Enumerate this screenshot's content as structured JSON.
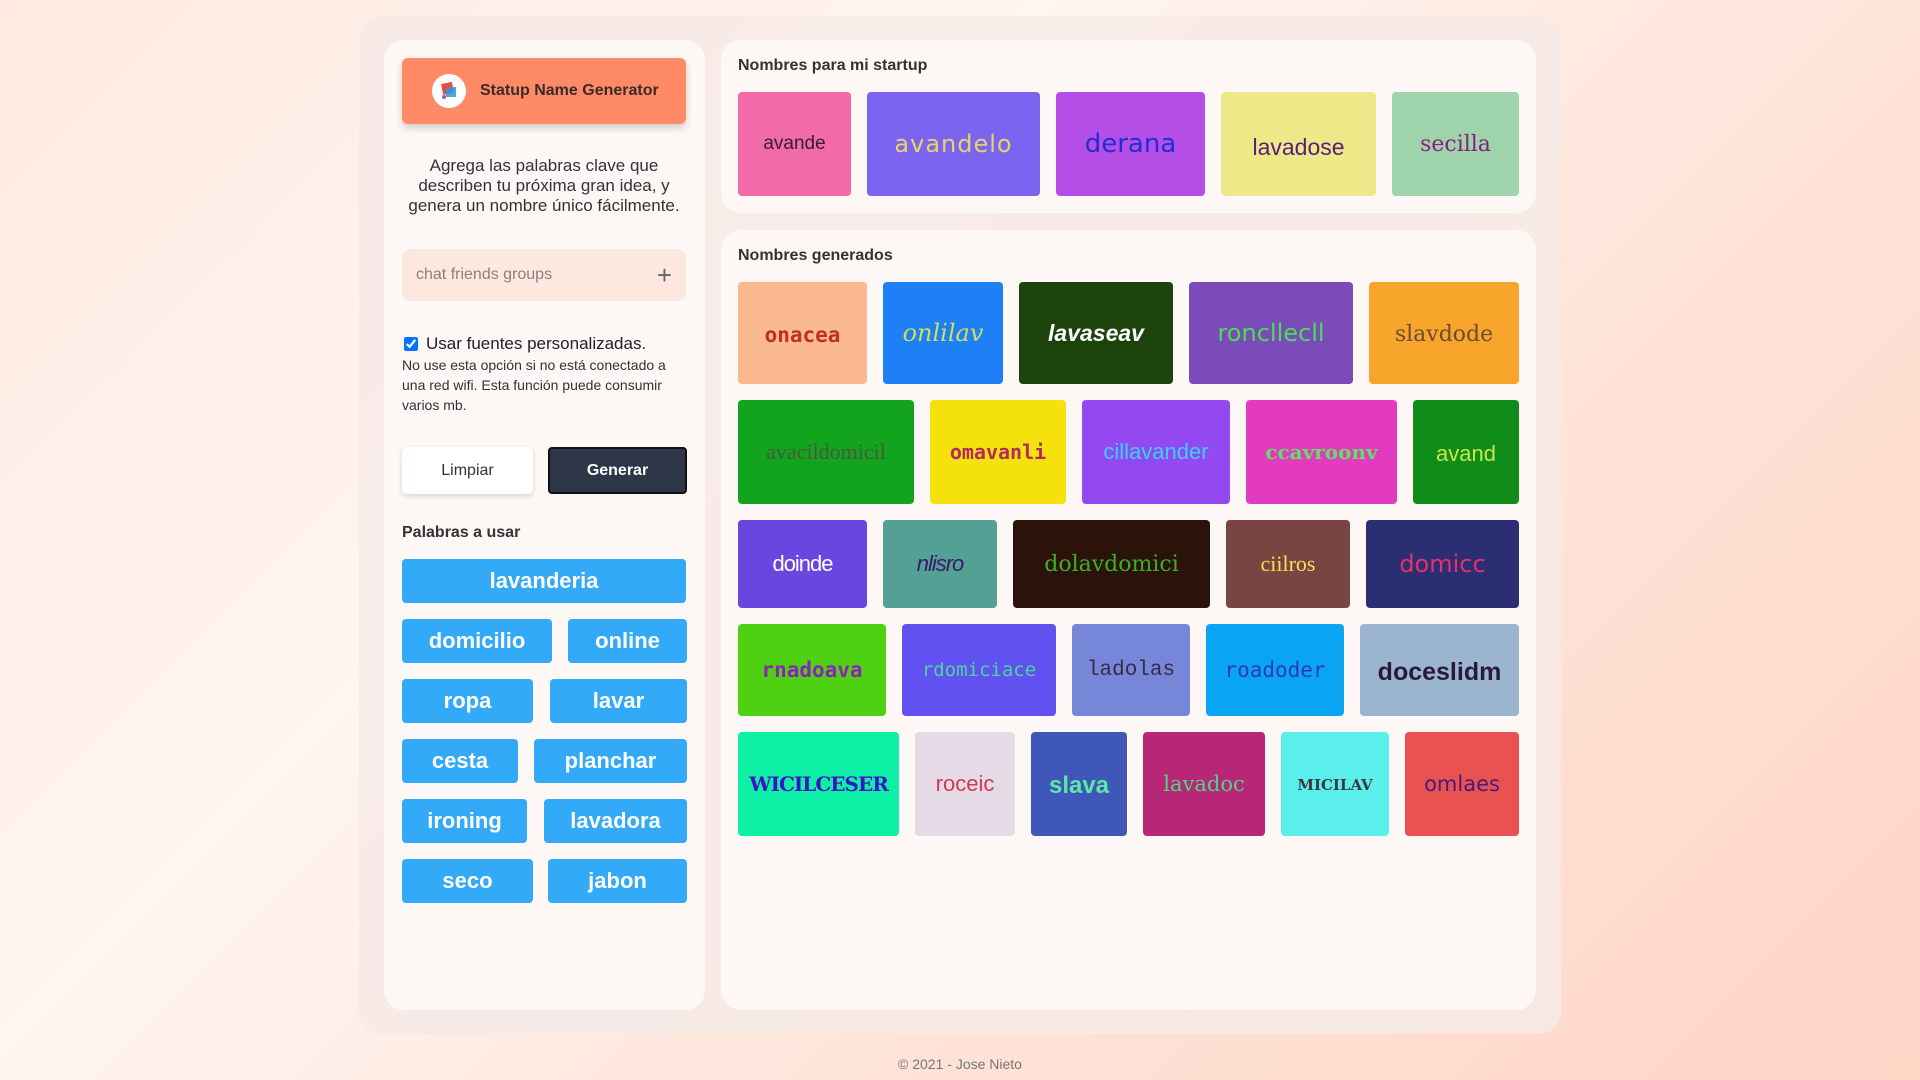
{
  "app": {
    "title": "Statup Name Generator",
    "description": "Agrega las palabras clave que describen tu próxima gran idea, y genera un nombre único fácilmente.",
    "keyword_placeholder": "chat friends groups",
    "custom_fonts_label": "Usar fuentes personalizadas.",
    "custom_fonts_checked": true,
    "custom_fonts_note": "No use esta opción si no está conectado a una red wifi. Esta función puede consumir varios mb.",
    "clear_label": "Limpiar",
    "generate_label": "Generar",
    "words_title": "Palabras a usar",
    "words": [
      "lavanderia",
      "domicilio",
      "online",
      "ropa",
      "lavar",
      "cesta",
      "planchar",
      "ironing",
      "lavadora",
      "seco",
      "jabon"
    ]
  },
  "favorites": {
    "title": "Nombres para mi startup",
    "names": [
      {
        "text": "avande",
        "bg": "#f06ba8",
        "fg": "#3a1a3a"
      },
      {
        "text": "avandelo",
        "bg": "#7b64f0",
        "fg": "#e8d36a"
      },
      {
        "text": "derana",
        "bg": "#b44ee6",
        "fg": "#1f2fd6"
      },
      {
        "text": "lavadose",
        "bg": "#ede888",
        "fg": "#5b1b7b"
      },
      {
        "text": "secilla",
        "bg": "#9fd3ac",
        "fg": "#8a1f7a"
      }
    ]
  },
  "generated": {
    "title": "Nombres generados",
    "names": [
      {
        "text": "onacea",
        "bg": "#fbb990",
        "fg": "#c0311c"
      },
      {
        "text": "onlilav",
        "bg": "#1f7ff5",
        "fg": "#c9e05a"
      },
      {
        "text": "lavaseav",
        "bg": "#1c430c",
        "fg": "#ffffff"
      },
      {
        "text": "roncllecll",
        "bg": "#7b4cb9",
        "fg": "#4ddd52"
      },
      {
        "text": "slavdode",
        "bg": "#f7a52b",
        "fg": "#6e4a3a"
      },
      {
        "text": "avacildomicil",
        "bg": "#12a31f",
        "fg": "#4a5a3a"
      },
      {
        "text": "omavanli",
        "bg": "#f5e10b",
        "fg": "#b32b5c"
      },
      {
        "text": "cillavander",
        "bg": "#9348f2",
        "fg": "#36d3f2"
      },
      {
        "text": "ccavroonv",
        "bg": "#e23bc0",
        "fg": "#5fe262"
      },
      {
        "text": "avand",
        "bg": "#0f8c19",
        "fg": "#c7e64a"
      },
      {
        "text": "doinde",
        "bg": "#6a46e0",
        "fg": "#ffffff"
      },
      {
        "text": "nlisro",
        "bg": "#55a095",
        "fg": "#3a1a6a"
      },
      {
        "text": "dolavdomici",
        "bg": "#2b130a",
        "fg": "#3fae24"
      },
      {
        "text": "ciilros",
        "bg": "#7a4440",
        "fg": "#f2e15a"
      },
      {
        "text": "domicc",
        "bg": "#2b2e72",
        "fg": "#e2316e"
      },
      {
        "text": "rnadoava",
        "bg": "#4fd112",
        "fg": "#8a24b8"
      },
      {
        "text": "rdomiciace",
        "bg": "#6151f0",
        "fg": "#4bd4a0"
      },
      {
        "text": "ladolas",
        "bg": "#7686d8",
        "fg": "#3a2a4a"
      },
      {
        "text": "roadoder",
        "bg": "#0aa5f2",
        "fg": "#2b3ab8"
      },
      {
        "text": "doceslidm",
        "bg": "#9bb4cf",
        "fg": "#2a1a3a"
      },
      {
        "text": "WICILCESER",
        "bg": "#0df0a6",
        "fg": "#3a14c4"
      },
      {
        "text": "roceic",
        "bg": "#e6dae6",
        "fg": "#d23a52"
      },
      {
        "text": "slava",
        "bg": "#3f57b8",
        "fg": "#5ce8a4"
      },
      {
        "text": "lavadoc",
        "bg": "#b82678",
        "fg": "#50d38a"
      },
      {
        "text": "MICILAV",
        "bg": "#5aefec",
        "fg": "#3a3a3a"
      },
      {
        "text": "omlaes",
        "bg": "#ea5252",
        "fg": "#4a1a7a"
      }
    ]
  },
  "footer": "© 2021 - Jose Nieto"
}
